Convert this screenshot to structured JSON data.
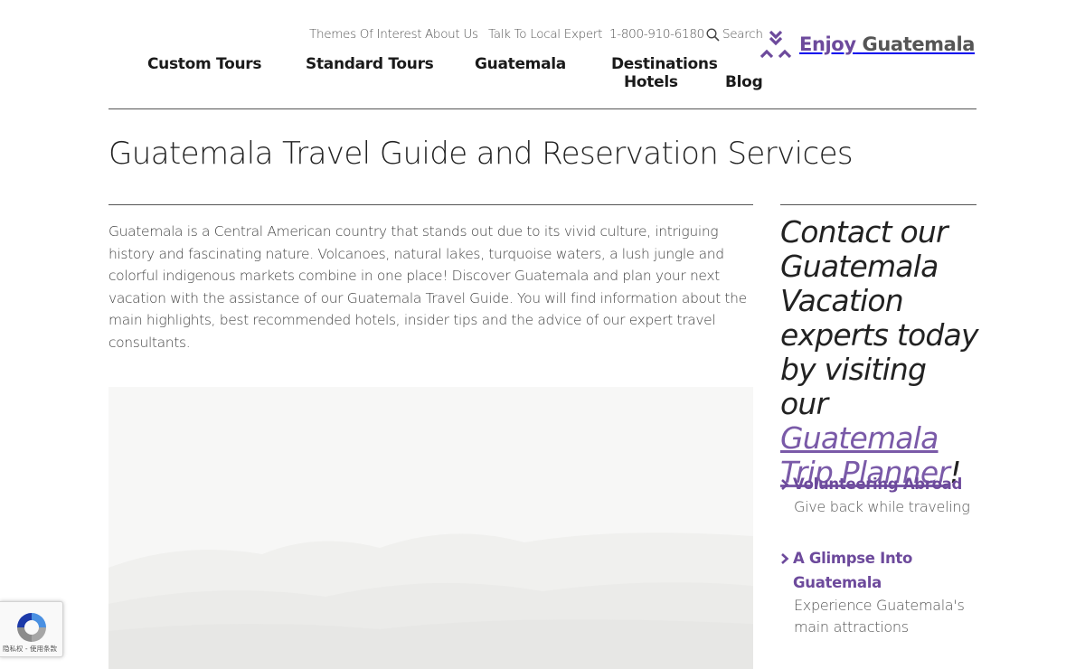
{
  "topbar": {
    "links": [
      "Themes Of Interest",
      "About Us",
      "Talk To Local Expert",
      "1-800-910-6180"
    ],
    "search_label": "Search"
  },
  "logo": {
    "word1": "Enjoy",
    "word2": "Guatemala",
    "brand_color": "#6d4a9c"
  },
  "nav": {
    "items": [
      "Custom Tours",
      "Standard Tours",
      "Guatemala",
      "Destinations",
      "Hotels",
      "Blog"
    ]
  },
  "page": {
    "title": "Guatemala Travel Guide and Reservation Services",
    "intro": "Guatemala is a Central American country that stands out due to its vivid culture, intriguing history and fascinating nature. Volcanoes, natural lakes, turquoise waters, a lush jungle and colorful indigenous markets combine in one place! Discover Guatemala and plan your next vacation with the assistance of our Guatemala Travel Guide. You will find information about the main highlights, best recommended hotels, insider tips and the advice of our expert travel consultants."
  },
  "sidebar": {
    "cta_text": "Contact our Guatemala Vacation experts today by visiting our ",
    "cta_link": "Guatemala Trip Planner",
    "cta_end": "!",
    "items": [
      {
        "title": "Volunteering Abroad",
        "desc": "Give back while traveling"
      },
      {
        "title": "A Glimpse Into Guatemala",
        "desc": "Experience Guatemala's main attractions"
      }
    ]
  },
  "recaptcha": {
    "text": "隐私权 - 使用条款"
  }
}
